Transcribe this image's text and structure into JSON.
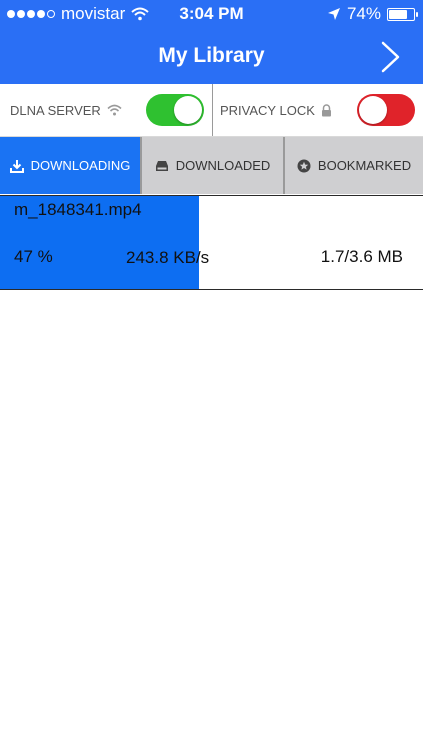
{
  "status_bar": {
    "carrier": "movistar",
    "time": "3:04 PM",
    "battery": "74%",
    "battery_fraction": 0.74
  },
  "nav": {
    "title": "My Library",
    "next_icon": "chevron-right-icon"
  },
  "toggles": {
    "dlna": {
      "label": "DLNA SERVER",
      "icon": "wifi-icon",
      "state": "on"
    },
    "privacy": {
      "label": "PRIVACY LOCK",
      "icon": "lock-icon",
      "state": "off"
    }
  },
  "tabs": [
    {
      "label": "DOWNLOADING",
      "icon": "download-icon",
      "active": true
    },
    {
      "label": "DOWNLOADED",
      "icon": "drive-icon",
      "active": false
    },
    {
      "label": "BOOKMARKED",
      "icon": "star-icon",
      "active": false
    }
  ],
  "downloads": [
    {
      "filename": "m_1848341.mp4",
      "percent_label": "47 %",
      "progress": 0.47,
      "speed": "243.8 KB/s",
      "size": "1.7/3.6 MB"
    }
  ],
  "colors": {
    "header": "#2a6ff5",
    "active_tab": "#1a73f3",
    "progress": "#0d6ef2",
    "toggle_on": "#2fc130",
    "toggle_off": "#e0232a"
  }
}
